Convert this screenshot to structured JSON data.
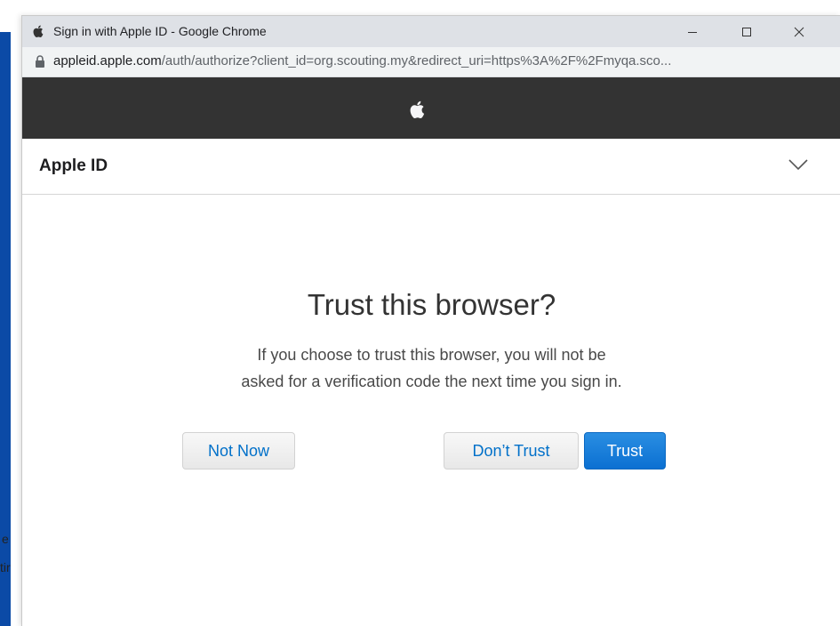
{
  "background": {
    "fragment_1": "e",
    "fragment_2": "tir"
  },
  "window": {
    "title": "Sign in with Apple ID - Google Chrome",
    "url_host": "appleid.apple.com",
    "url_path": "/auth/authorize?client_id=org.scouting.my&redirect_uri=https%3A%2F%2Fmyqa.sco..."
  },
  "header": {
    "brand_icon": "apple-logo-icon"
  },
  "appleid_bar": {
    "title": "Apple ID"
  },
  "dialog": {
    "heading": "Trust this browser?",
    "description_line1": "If you choose to trust this browser, you will not be",
    "description_line2": "asked for a verification code the next time you sign in.",
    "buttons": {
      "not_now": "Not Now",
      "dont_trust": "Don’t Trust",
      "trust": "Trust"
    }
  },
  "colors": {
    "header_bg": "#333333",
    "link_blue": "#0070c9",
    "primary_blue": "#0b70d2"
  }
}
